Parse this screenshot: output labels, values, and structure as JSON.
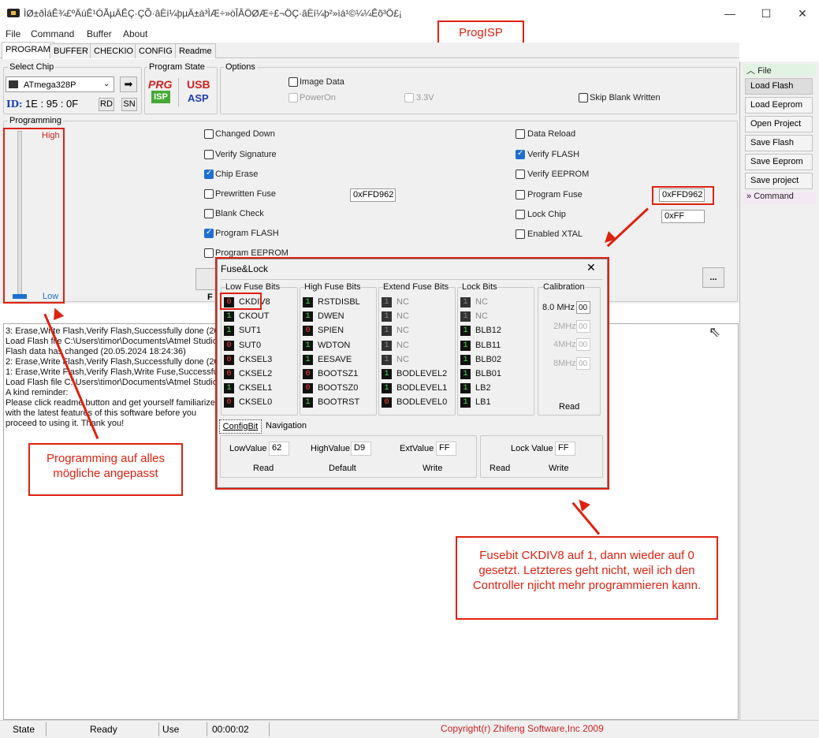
{
  "window": {
    "title": "ÌØ±ðÌáÊ¾£ºÄúÊ¹ÓÃµÄÊÇ·ÇÕ·âÈí¼þµÄ±à³ÌÆ÷»òÎÂÖØÆ÷£¬ÖÇ·âÈí¼þ²»ìá¹©¼¼Êõ³Ö£¡",
    "minimize": "—",
    "maximize": "☐",
    "close": "✕"
  },
  "menu": [
    "File",
    "Command",
    "Buffer",
    "About"
  ],
  "header_label": "ProgISP",
  "tabs": [
    "PROGRAM",
    "BUFFER",
    "CHECKIO",
    "CONFIG",
    "Readme"
  ],
  "select_chip": {
    "label": "Select Chip",
    "chip": "ATmega328P",
    "id_label": "ID:",
    "id_value": "1E : 95 : 0F",
    "rd": "RD",
    "sn": "SN"
  },
  "program_state": {
    "label": "Program State",
    "prg": "PRG",
    "isp": "ISP",
    "usb": "USB",
    "asp": "ASP"
  },
  "options": {
    "label": "Options",
    "image_data": "Image Data",
    "power_on": "PowerOn",
    "v33": "3.3V",
    "skip_blank": "Skip Blank Written"
  },
  "programming": {
    "label": "Programming",
    "high": "High",
    "low": "Low",
    "left_options": [
      {
        "label": "Changed Down",
        "checked": false
      },
      {
        "label": "Verify Signature",
        "checked": false
      },
      {
        "label": "Chip Erase",
        "checked": true
      },
      {
        "label": "Prewritten Fuse",
        "checked": false
      },
      {
        "label": "Blank Check",
        "checked": false
      },
      {
        "label": "Program FLASH",
        "checked": true
      },
      {
        "label": "Program EEPROM",
        "checked": false
      }
    ],
    "right_options": [
      {
        "label": "Data Reload",
        "checked": false
      },
      {
        "label": "Verify FLASH",
        "checked": true
      },
      {
        "label": "Verify EEPROM",
        "checked": false
      },
      {
        "label": "Program Fuse",
        "checked": false
      },
      {
        "label": "Lock Chip",
        "checked": false
      },
      {
        "label": "Enabled XTAL",
        "checked": false
      }
    ],
    "prewritten_fuse_value": "0xFFD962",
    "program_fuse_value": "0xFFD962",
    "lock_value": "0xFF",
    "ellipsis": "...",
    "f_label": "F"
  },
  "sidebar": {
    "file_header": "File",
    "items": [
      "Load Flash",
      "Load Eeprom",
      "Open Project",
      "Save Flash",
      "Save Eeprom",
      "Save project"
    ],
    "command_header": "Command"
  },
  "log": [
    "3: Erase,Write Flash,Verify Flash,Successfully done (20",
    "Load Flash file C:\\Users\\timor\\Documents\\Atmel Studio",
    "Flash data has changed (20.05.2024 18:24:36)",
    "2: Erase,Write Flash,Verify Flash,Successfully done (20",
    "1: Erase,Write Flash,Verify Flash,Write Fuse,Successful",
    "Load Flash file C:\\Users\\timor\\Documents\\Atmel Studio",
    "A kind reminder:",
    "Please click readme button and get yourself familiarize",
    "with the latest features of this software before you",
    "proceed to using it. Thank you!"
  ],
  "annotations": {
    "programming_note": "Programming auf alles mögliche angepasst",
    "fuse_note": "Fusebit CKDIV8 auf 1, dann wieder auf 0 gesetzt. Letzteres geht nicht, weil ich den Controller njicht mehr programmieren kann."
  },
  "dialog": {
    "title": "Fuse&Lock",
    "close": "✕",
    "low_header": "Low Fuse Bits",
    "high_header": "High Fuse Bits",
    "extend_header": "Extend Fuse Bits",
    "lock_header": "Lock Bits",
    "calibration_header": "Calibration",
    "low_bits": [
      {
        "v": "0",
        "name": "CKDIV8"
      },
      {
        "v": "1",
        "name": "CKOUT"
      },
      {
        "v": "1",
        "name": "SUT1"
      },
      {
        "v": "0",
        "name": "SUT0"
      },
      {
        "v": "0",
        "name": "CKSEL3"
      },
      {
        "v": "0",
        "name": "CKSEL2"
      },
      {
        "v": "1",
        "name": "CKSEL1"
      },
      {
        "v": "0",
        "name": "CKSEL0"
      }
    ],
    "high_bits": [
      {
        "v": "1",
        "name": "RSTDISBL"
      },
      {
        "v": "1",
        "name": "DWEN"
      },
      {
        "v": "0",
        "name": "SPIEN"
      },
      {
        "v": "1",
        "name": "WDTON"
      },
      {
        "v": "1",
        "name": "EESAVE"
      },
      {
        "v": "0",
        "name": "BOOTSZ1"
      },
      {
        "v": "0",
        "name": "BOOTSZ0"
      },
      {
        "v": "1",
        "name": "BOOTRST"
      }
    ],
    "extend_bits": [
      {
        "v": "1",
        "name": "NC"
      },
      {
        "v": "1",
        "name": "NC"
      },
      {
        "v": "1",
        "name": "NC"
      },
      {
        "v": "1",
        "name": "NC"
      },
      {
        "v": "1",
        "name": "NC"
      },
      {
        "v": "1",
        "name": "BODLEVEL2"
      },
      {
        "v": "1",
        "name": "BODLEVEL1"
      },
      {
        "v": "0",
        "name": "BODLEVEL0"
      }
    ],
    "lock_bits": [
      {
        "v": "1",
        "name": "NC"
      },
      {
        "v": "1",
        "name": "NC"
      },
      {
        "v": "1",
        "name": "BLB12"
      },
      {
        "v": "1",
        "name": "BLB11"
      },
      {
        "v": "1",
        "name": "BLB02"
      },
      {
        "v": "1",
        "name": "BLB01"
      },
      {
        "v": "1",
        "name": "LB2"
      },
      {
        "v": "1",
        "name": "LB1"
      }
    ],
    "calibration": [
      {
        "label": "8.0 MHz",
        "value": "00",
        "enabled": true
      },
      {
        "label": "2MHz",
        "value": "00",
        "enabled": false
      },
      {
        "label": "4MHz",
        "value": "00",
        "enabled": false
      },
      {
        "label": "8MHz",
        "value": "00",
        "enabled": false
      }
    ],
    "cal_read": "Read",
    "subtabs": [
      "ConfigBit",
      "Navigation"
    ],
    "low_value_label": "LowValue",
    "low_value": "62",
    "high_value_label": "HighValue",
    "high_value": "D9",
    "ext_value_label": "ExtValue",
    "ext_value": "FF",
    "lock_value_label": "Lock Value",
    "lock_value": "FF",
    "read": "Read",
    "default": "Default",
    "write": "Write",
    "lock_read": "Read",
    "lock_write": "Write"
  },
  "status": {
    "state_label": "State",
    "state_value": "Ready",
    "use_times_label": "Use Times",
    "use_times_value": "00:00:02",
    "copyright": "Copyright(r) Zhifeng Software,Inc 2009"
  },
  "colors": {
    "annotation_red": "#dd2211",
    "checkbox_blue": "#1e6fd0",
    "bit_one": "#4ce04c",
    "bit_zero": "#ff4040"
  }
}
